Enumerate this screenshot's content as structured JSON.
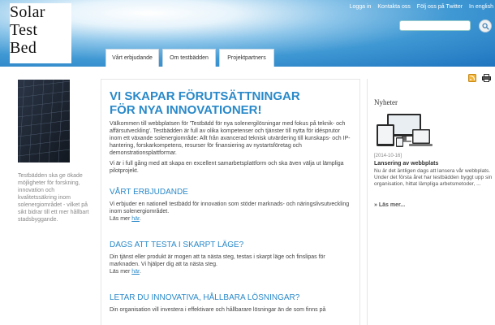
{
  "logo": {
    "line1": "Solar",
    "line2": "Test",
    "line3": "Bed"
  },
  "top_links": [
    "Logga in",
    "Kontakta oss",
    "Följ oss på Twitter",
    "In english"
  ],
  "search": {
    "placeholder": "",
    "value": ""
  },
  "tabs": [
    "Vårt erbjudande",
    "Om testbädden",
    "Projektpartners"
  ],
  "left_caption": "Testbädden ska ge ökade möjligheter för forskning, innovation och kvalitetssäkring inom solenergiområdet - vilket på sikt bidrar till ett mer hållbart stadsbyggande.",
  "main": {
    "headline1": "VI SKAPAR FÖRUTSÄTTNINGAR",
    "headline2": "FÖR NYA INNOVATIONER!",
    "intro": "Välkommen till webbplatsen för 'Testbädd för nya solenergilösningar med fokus på teknik- och affärsutveckling'. Testbädden är full av olika kompetenser och tjänster till nytta för idésprutor inom ett växande solenergiområde: Allt från avancerad teknisk utvärdering till kunskaps- och IP-hantering, forskarkompetens, resurser för finansiering av nystartsföretag och demonstrationsplattformar.",
    "intro2": "Vi är i full gång med att skapa en excellent samarbetsplattform och ska även välja ut lämpliga pilotprojekt.",
    "section1_title": "VÅRT ERBJUDANDE",
    "section1_text": "Vi erbjuder en nationell testbädd för innovation som stöder marknads- och näringslivsutveckling inom solenergiområdet.",
    "section2_title": "DAGS ATT TESTA I SKARPT LÄGE?",
    "section2_text": "Din tjänst eller produkt är mogen att ta nästa steg, testas i skarpt läge och finslipas för marknaden. Vi hjälper dig att ta nästa steg.",
    "section3_title": "LETAR DU INNOVATIVA, HÅLLBARA LÖSNINGAR?",
    "section3_text": "Din organisation vill investera i effektivare och hållbarare lösningar än de som finns på",
    "read_more_prefix": "Läs mer",
    "read_more_link": "här",
    "read_more_suffix": "."
  },
  "news": {
    "title": "Nyheter",
    "date": "[2014-10-16]",
    "item_title": "Lansering av webbplats",
    "item_text": "Nu är det äntligen dags att lansera vår webbplats. Under det första året har testbädden byggt upp sin organisation, hittat lämpliga arbetsmetoder, ...",
    "more": "» Läs mer..."
  },
  "icons": {
    "search": "search-icon",
    "rss": "rss-icon",
    "print": "print-icon"
  }
}
